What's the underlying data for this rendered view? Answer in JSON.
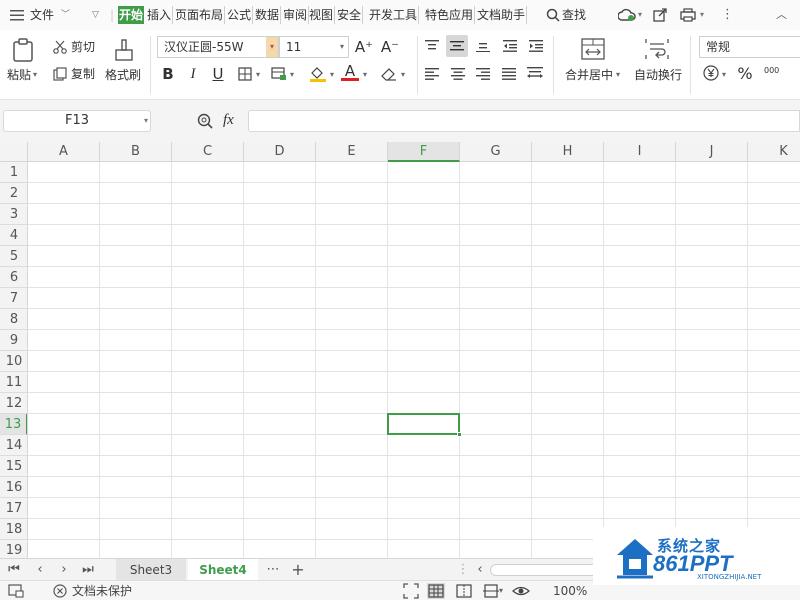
{
  "menubar": {
    "file_label": "文件",
    "tabs": [
      {
        "label": "开始",
        "active": true
      },
      {
        "label": "插入",
        "active": false
      },
      {
        "label": "页面布局",
        "active": false
      },
      {
        "label": "公式",
        "active": false
      },
      {
        "label": "数据",
        "active": false
      },
      {
        "label": "审阅",
        "active": false
      },
      {
        "label": "视图",
        "active": false
      },
      {
        "label": "安全",
        "active": false
      },
      {
        "label": "开发工具",
        "active": false
      },
      {
        "label": "特色应用",
        "active": false
      },
      {
        "label": "文档助手",
        "active": false
      }
    ],
    "search_label": "查找"
  },
  "ribbon": {
    "paste_label": "粘贴",
    "cut_label": "剪切",
    "copy_label": "复制",
    "format_painter_label": "格式刷",
    "font_name": "汉仪正圆-55W",
    "font_size": "11",
    "merge_center_label": "合并居中",
    "wrap_text_label": "自动换行",
    "number_format": "常规",
    "grow_font": "A⁺",
    "shrink_font": "A⁻",
    "bold": "B",
    "italic": "I",
    "underline": "U",
    "font_color_glyph": "A",
    "percent_glyph": "%",
    "thousands_glyph": "000"
  },
  "formula_bar": {
    "cell_reference": "F13",
    "fx_label": "fx",
    "formula_value": ""
  },
  "grid": {
    "columns": [
      "A",
      "B",
      "C",
      "D",
      "E",
      "F",
      "G",
      "H",
      "I",
      "J",
      "K"
    ],
    "rows": [
      "1",
      "2",
      "3",
      "4",
      "5",
      "6",
      "7",
      "8",
      "9",
      "10",
      "11",
      "12",
      "13",
      "14",
      "15",
      "16",
      "17",
      "18",
      "19"
    ],
    "selected_column": "F",
    "selected_row": "13"
  },
  "sheets": {
    "tabs": [
      {
        "label": "Sheet3",
        "active": false
      },
      {
        "label": "Sheet4",
        "active": true
      }
    ],
    "more_glyph": "⋯",
    "add_glyph": "+"
  },
  "statusbar": {
    "protection_label": "文档未保护",
    "zoom_label": "100%"
  },
  "watermark": {
    "site_name": "系统之家",
    "brand": "861PPT",
    "url_text": "XITONGZHIJIA.NET"
  },
  "colors": {
    "accent": "#3f9d4a",
    "watermark": "#1d6fc4"
  }
}
